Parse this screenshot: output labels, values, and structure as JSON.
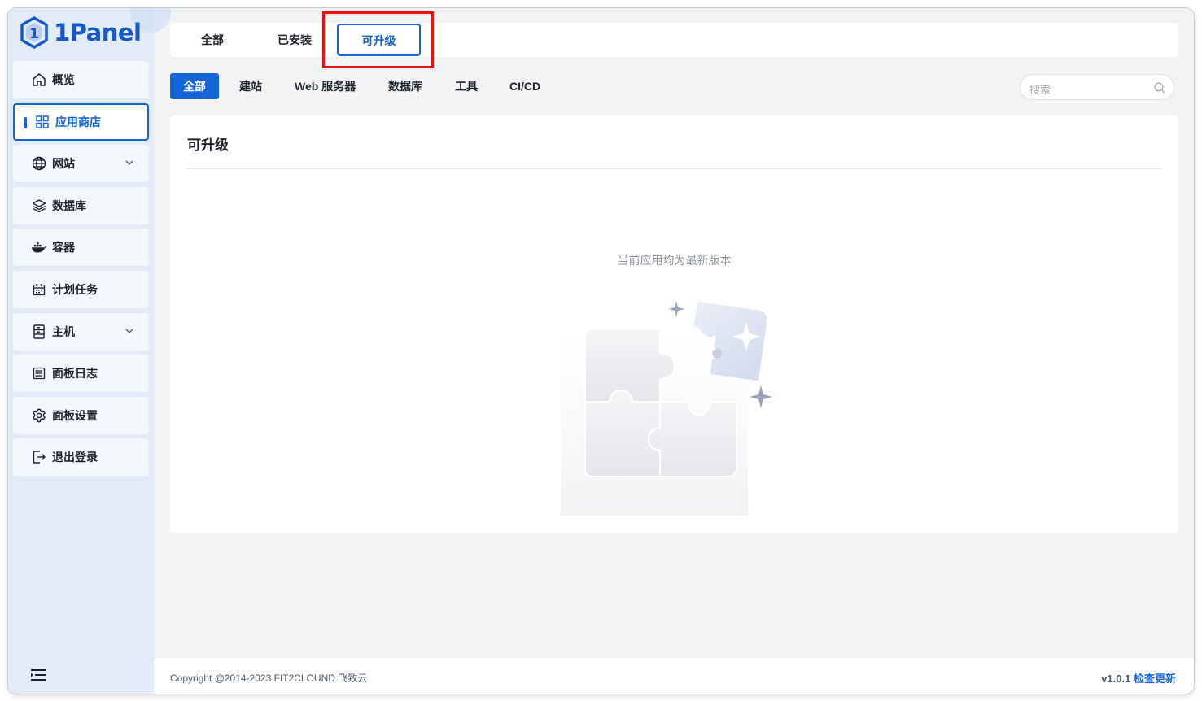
{
  "brand": {
    "name": "1Panel",
    "color": "#1559c9"
  },
  "sidebar": {
    "items": [
      {
        "label": "概览",
        "icon": "home-icon",
        "active": false,
        "has_children": false
      },
      {
        "label": "应用商店",
        "icon": "apps-grid-icon",
        "active": true,
        "has_children": false
      },
      {
        "label": "网站",
        "icon": "globe-icon",
        "active": false,
        "has_children": true
      },
      {
        "label": "数据库",
        "icon": "layers-icon",
        "active": false,
        "has_children": false
      },
      {
        "label": "容器",
        "icon": "docker-icon",
        "active": false,
        "has_children": false
      },
      {
        "label": "计划任务",
        "icon": "calendar-icon",
        "active": false,
        "has_children": false
      },
      {
        "label": "主机",
        "icon": "server-icon",
        "active": false,
        "has_children": true
      },
      {
        "label": "面板日志",
        "icon": "log-icon",
        "active": false,
        "has_children": false
      },
      {
        "label": "面板设置",
        "icon": "gear-icon",
        "active": false,
        "has_children": false
      },
      {
        "label": "退出登录",
        "icon": "logout-icon",
        "active": false,
        "has_children": false
      }
    ],
    "collapse_icon": "menu-collapse-icon"
  },
  "top_tabs": [
    {
      "label": "全部",
      "active": false
    },
    {
      "label": "已安装",
      "active": false
    },
    {
      "label": "可升级",
      "active": true
    }
  ],
  "sub_tabs": [
    {
      "label": "全部",
      "active": true
    },
    {
      "label": "建站",
      "active": false
    },
    {
      "label": "Web 服务器",
      "active": false
    },
    {
      "label": "数据库",
      "active": false
    },
    {
      "label": "工具",
      "active": false
    },
    {
      "label": "CI/CD",
      "active": false
    }
  ],
  "search": {
    "placeholder": "搜索",
    "icon": "search-icon"
  },
  "card": {
    "title": "可升级",
    "empty_text": "当前应用均为最新版本",
    "illustration": "puzzle-pieces-empty-icon"
  },
  "footer": {
    "copyright": "Copyright @2014-2023 FIT2CLOUND 飞致云",
    "version": "v1.0.1",
    "update_link": "检查更新"
  },
  "colors": {
    "accent": "#1565d8",
    "highlight": "#ea1111",
    "sidebar_bg": "#e3ebf8"
  }
}
